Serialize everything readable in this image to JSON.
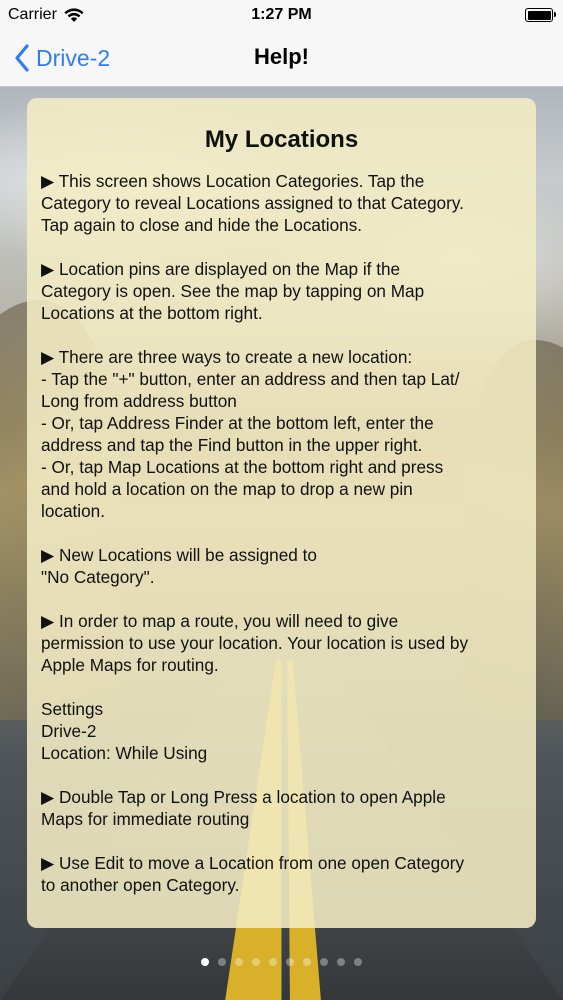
{
  "status_bar": {
    "carrier": "Carrier",
    "time": "1:27 PM"
  },
  "nav": {
    "back_label": "Drive-2",
    "title": "Help!"
  },
  "help": {
    "title": "My Locations",
    "paragraphs": [
      [
        "▶ This screen shows Location Categories. Tap the",
        "Category to reveal Locations assigned to that Category.",
        "Tap again to close and hide the Locations."
      ],
      [
        "▶ Location pins are displayed on the Map if the",
        "Category is open. See the map by tapping on Map",
        "Locations at the bottom right."
      ],
      [
        "▶ There are three ways to create a new location:",
        " - Tap the \"+\" button, enter an address and then tap Lat/",
        "Long from address button",
        "- Or, tap Address Finder at the bottom left, enter the",
        "address and tap the Find button in the upper right.",
        "- Or, tap Map Locations at the bottom right and press",
        "and hold a location on the map to drop a new pin",
        "location."
      ],
      [
        "▶ New Locations will be assigned to",
        "\"No Category\"."
      ],
      [
        "▶ In order to map a route, you will need to give",
        "permission to use your location. Your location is used by",
        "Apple Maps for routing."
      ],
      [
        "Settings",
        "Drive-2",
        "Location: While Using"
      ],
      [
        "▶ Double Tap or Long Press a location to open Apple",
        "Maps for immediate routing"
      ],
      [
        "▶ Use Edit to move a Location from one open Category",
        "to another open Category."
      ]
    ]
  },
  "page_control": {
    "total_pages": 10,
    "current_page": 1
  },
  "colors": {
    "tint": "#2f7cf6",
    "card_background": "#f3ecc4"
  }
}
